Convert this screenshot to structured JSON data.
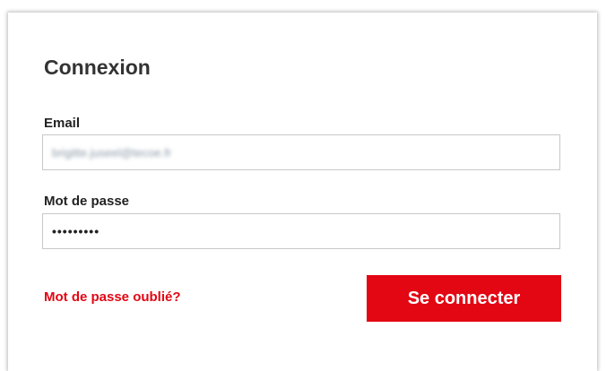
{
  "login": {
    "title": "Connexion",
    "email_label": "Email",
    "email_value": "brigitte.juseel@tecoe.fr",
    "password_label": "Mot de passe",
    "password_value": "•••••••••",
    "forgot_link": "Mot de passe oublié?",
    "submit_label": "Se connecter"
  },
  "colors": {
    "accent": "#e30613",
    "border": "#c8c8c8",
    "title_text": "#333333"
  }
}
